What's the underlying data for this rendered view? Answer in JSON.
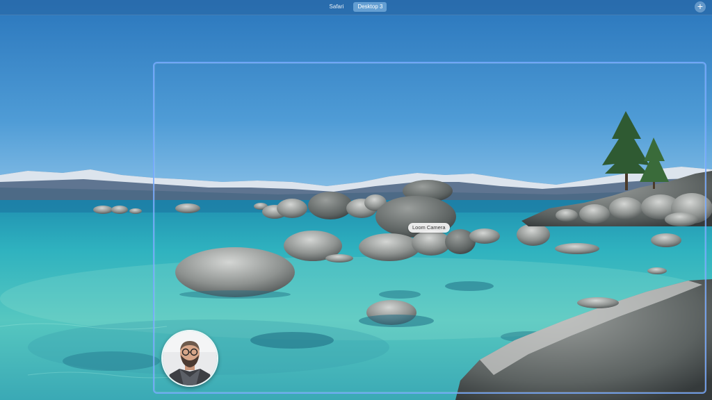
{
  "spaces_bar": {
    "tabs": [
      {
        "label": "Safari",
        "active": false
      },
      {
        "label": "Desktop 3",
        "active": true
      }
    ],
    "add_button": "+"
  },
  "capture": {
    "camera_label": "Loom Camera"
  },
  "colors": {
    "frame": "#78aaff",
    "sky_top": "#2b78bd",
    "water": "#3fb7c4"
  }
}
